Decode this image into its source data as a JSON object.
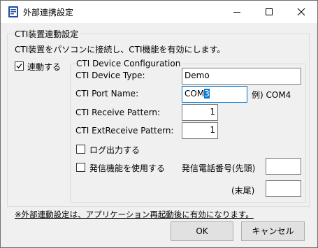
{
  "window": {
    "title": "外部連携設定"
  },
  "group": {
    "legend": "CTI装置連動設定",
    "description": "CTI装置をパソコンに接続し、CTI機能を有効にします。",
    "link_checkbox": {
      "label": "連動する",
      "checked": true
    }
  },
  "cti": {
    "legend": "CTI Device Configuration",
    "device_type": {
      "label": "CTI Device Type:",
      "value": "Demo"
    },
    "port_name": {
      "label": "CTI Port Name:",
      "value_prefix": "COM",
      "value_selected": "3",
      "example": "例) COM4"
    },
    "receive_pattern": {
      "label": "CTI Receive Pattern:",
      "value": "1"
    },
    "ext_receive_pattern": {
      "label": "CTI ExtReceive Pattern:",
      "value": "1"
    },
    "log_output": {
      "label": "ログ出力する",
      "checked": false
    },
    "outgoing": {
      "label": "発信機能を使用する",
      "checked": false
    },
    "phone_prefix": {
      "label": "発信電話番号(先頭)",
      "value": ""
    },
    "phone_suffix": {
      "label": "(末尾)",
      "value": ""
    }
  },
  "footer": {
    "note": "※外部連動設定は、アプリケーション再起動後に有効になります。",
    "ok_label": "OK",
    "cancel_label": "キャンセル"
  },
  "colors": {
    "accent": "#0078d7",
    "selection": "#0078d7"
  }
}
